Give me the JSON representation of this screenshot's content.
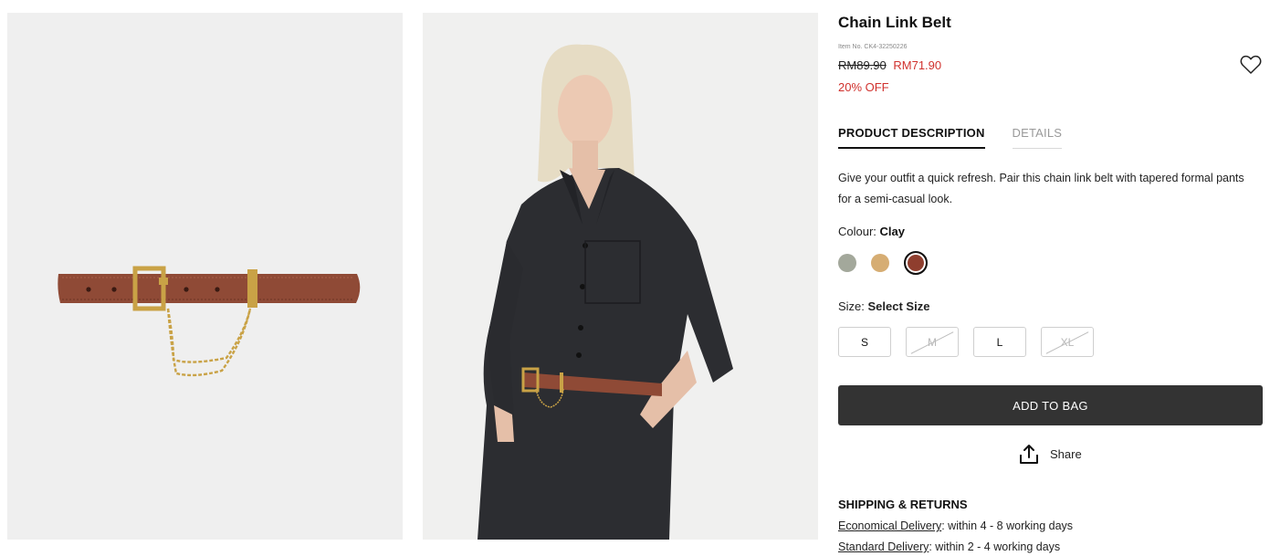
{
  "product": {
    "title": "Chain Link Belt",
    "item_no": "Item No. CK4-32250226",
    "old_price": "RM89.90",
    "new_price": "RM71.90",
    "discount": "20% OFF",
    "wishlist_icon": "heart-icon"
  },
  "tabs": [
    {
      "label": "PRODUCT DESCRIPTION",
      "active": true
    },
    {
      "label": "DETAILS",
      "active": false
    }
  ],
  "description": "Give your outfit a quick refresh. Pair this chain link belt with tapered formal pants for a semi-casual look.",
  "colour": {
    "label": "Colour: ",
    "selected": "Clay",
    "swatches": [
      {
        "name": "sage",
        "hex": "#a3a89b"
      },
      {
        "name": "tan",
        "hex": "#d6ad73"
      },
      {
        "name": "clay",
        "hex": "#8f3e2e",
        "selected": true
      }
    ]
  },
  "size": {
    "label": "Size: ",
    "selected": "Select Size",
    "options": [
      {
        "label": "S",
        "available": true
      },
      {
        "label": "M",
        "available": false
      },
      {
        "label": "L",
        "available": true
      },
      {
        "label": "XL",
        "available": false
      }
    ]
  },
  "actions": {
    "add_to_bag": "ADD TO BAG",
    "share": "Share",
    "share_icon": "share-upload-icon"
  },
  "shipping": {
    "title": "SHIPPING & RETURNS",
    "lines": [
      {
        "link": "Economical Delivery",
        "text": ": within 4 - 8 working days"
      },
      {
        "link": "Standard Delivery",
        "text": ": within 2 - 4 working days"
      }
    ]
  },
  "colors": {
    "accent_red": "#d0312d",
    "button_bg": "#333333",
    "belt_clay": "#8f4a36"
  }
}
